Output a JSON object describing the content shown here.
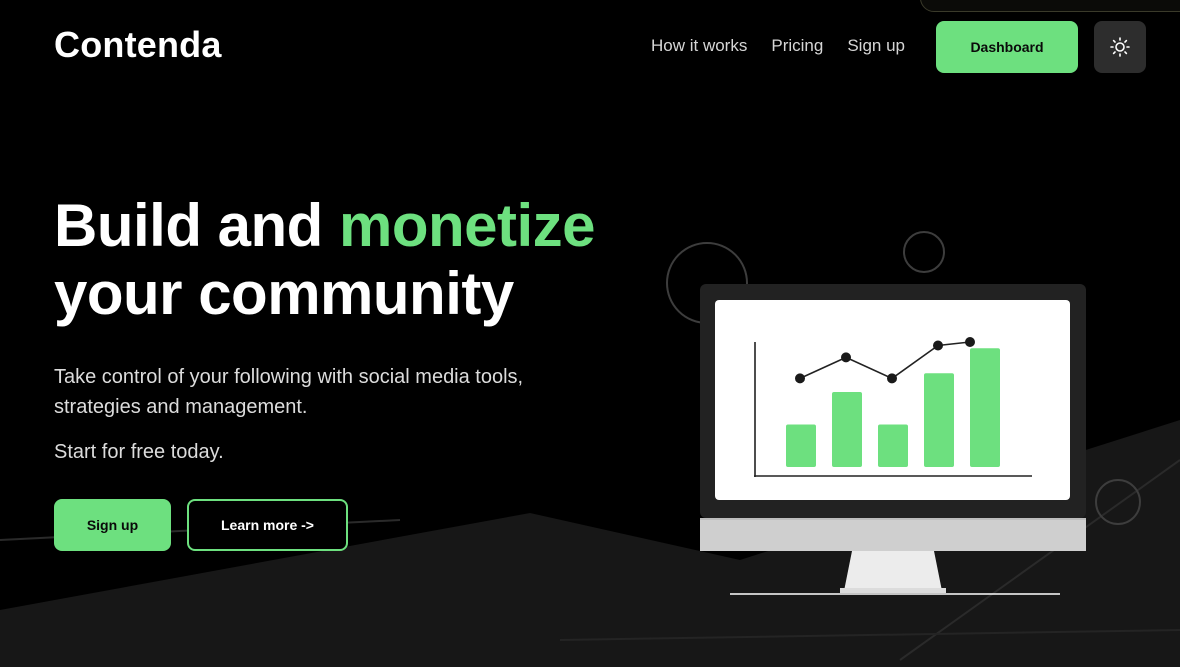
{
  "brand": {
    "name": "Contenda"
  },
  "nav": {
    "links": [
      {
        "label": "How it works"
      },
      {
        "label": "Pricing"
      },
      {
        "label": "Sign up"
      }
    ],
    "dashboard_label": "Dashboard",
    "theme_toggle_icon": "sun-icon"
  },
  "hero": {
    "title_part1": "Build and ",
    "title_accent": "monetize",
    "title_part2": "your community",
    "subtitle": "Take control of your following with social media tools, strategies and management.",
    "cta_text": "Start for free today.",
    "primary_button": "Sign up",
    "secondary_button": "Learn more ->"
  },
  "illustration": {
    "type": "monitor-with-bar-and-line-chart",
    "bar_levels": [
      0.34,
      0.6,
      0.34,
      0.75,
      0.95
    ],
    "line_levels": [
      0.48,
      0.78,
      0.48,
      0.95,
      1.0
    ]
  },
  "colors": {
    "accent": "#6de07f",
    "background": "#000000",
    "surface": "#2d2d2d",
    "text": "#ffffff"
  }
}
